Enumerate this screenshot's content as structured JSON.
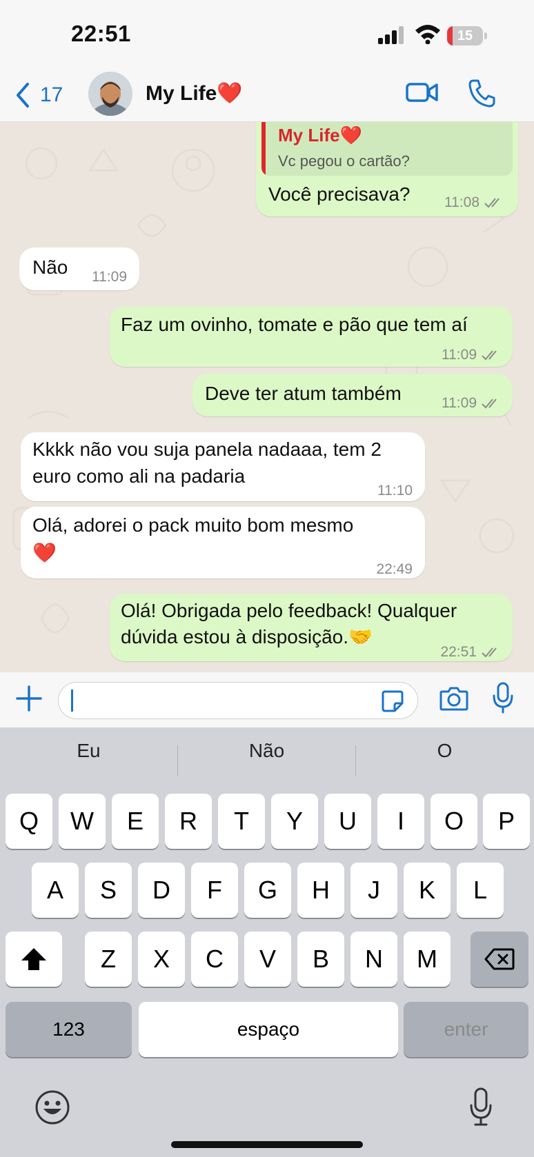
{
  "status_bar": {
    "time": "22:51",
    "battery": "15",
    "battery_level": 0.15,
    "battery_color": "#e8373c"
  },
  "nav": {
    "back_count": "17",
    "contact_name": "My Life❤️",
    "accent": "#1a73c9"
  },
  "messages": [
    {
      "direction": "outgoing",
      "quote_author": "My Life❤️",
      "quote_text": "Vc pegou o cartão?",
      "text": "Você precisava?",
      "time": "11:08"
    },
    {
      "direction": "incoming",
      "text": "Não",
      "time": "11:09"
    },
    {
      "direction": "outgoing",
      "text": "Faz um ovinho, tomate e pão que tem aí",
      "time": "11:09"
    },
    {
      "direction": "outgoing",
      "text": "Deve ter atum também",
      "time": "11:09"
    },
    {
      "direction": "incoming",
      "lines": [
        "Kkkk não vou suja panela nadaaa, tem 2",
        "euro como ali na padaria"
      ],
      "time": "11:10"
    },
    {
      "direction": "incoming",
      "lines": [
        "Olá, adorei o pack muito bom mesmo",
        "❤️"
      ],
      "time": "22:49"
    },
    {
      "direction": "outgoing",
      "lines": [
        "Olá! Obrigada pelo feedback! Qualquer",
        "dúvida estou à disposição.🤝"
      ],
      "time": "22:51"
    }
  ],
  "keyboard": {
    "suggestions": [
      "Eu",
      "Não",
      "O"
    ],
    "row1": [
      "Q",
      "W",
      "E",
      "R",
      "T",
      "Y",
      "U",
      "I",
      "O",
      "P"
    ],
    "row2": [
      "A",
      "S",
      "D",
      "F",
      "G",
      "H",
      "J",
      "K",
      "L"
    ],
    "row3": [
      "Z",
      "X",
      "C",
      "V",
      "B",
      "N",
      "M"
    ],
    "numbers_label": "123",
    "space_label": "espaço",
    "enter_label": "enter"
  },
  "icons": {
    "back": "chevron-left-icon",
    "video": "video-call-icon",
    "phone": "phone-icon",
    "plus": "plus-icon",
    "sticker": "sticker-icon",
    "camera": "camera-icon",
    "mic": "mic-icon",
    "shift": "shift-icon",
    "delete": "backspace-icon",
    "emoji": "emoji-icon",
    "dictation": "dictation-mic-icon"
  },
  "colors": {
    "outgoing_bubble": "#dcf8c6",
    "incoming_bubble": "#ffffff",
    "chat_bg": "#ece5dd",
    "read_ticks": "#8a8a8a"
  }
}
